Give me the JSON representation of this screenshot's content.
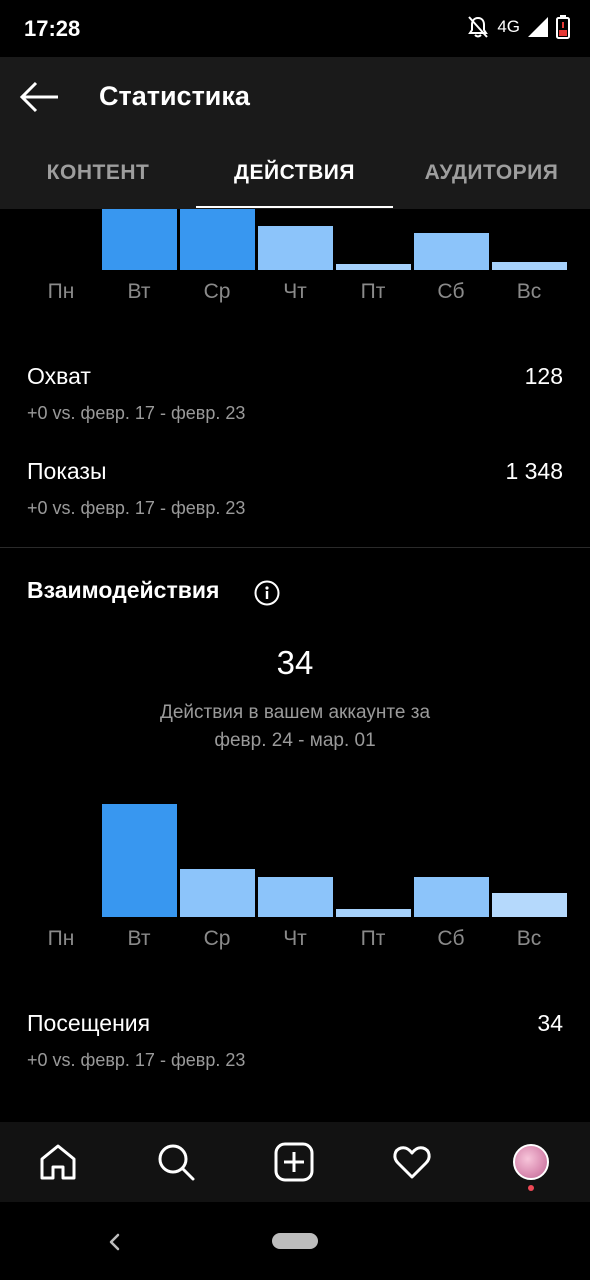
{
  "status_bar": {
    "time": "17:28",
    "network": "4G"
  },
  "header": {
    "title": "Статистика"
  },
  "tabs": [
    {
      "label": "КОНТЕНТ",
      "active": false
    },
    {
      "label": "ДЕЙСТВИЯ",
      "active": true
    },
    {
      "label": "АУДИТОРИЯ",
      "active": false
    }
  ],
  "top_chart": {
    "days": [
      "Пн",
      "Вт",
      "Ср",
      "Чт",
      "Пт",
      "Сб",
      "Вс"
    ]
  },
  "reach": {
    "label": "Охват",
    "value": "128",
    "compare": "+0 vs. февр. 17 - февр. 23"
  },
  "impressions": {
    "label": "Показы",
    "value": "1 348",
    "compare": "+0 vs. февр. 17 - февр. 23"
  },
  "interactions": {
    "title": "Взаимодействия",
    "total": "34",
    "caption_line1": "Действия в вашем аккаунте за",
    "caption_line2": "февр. 24 - мар. 01"
  },
  "chart_data": {
    "type": "bar",
    "categories": [
      "Пн",
      "Вт",
      "Ср",
      "Чт",
      "Пт",
      "Сб",
      "Вс"
    ],
    "values": [
      0,
      14,
      6,
      5,
      1,
      5,
      3
    ],
    "xlabel": "",
    "ylabel": "",
    "colors": {
      "highest": "#3897f0",
      "other": "#8cc4fa"
    }
  },
  "visits": {
    "label": "Посещения",
    "value": "34",
    "compare": "+0 vs. февр. 17 - февр. 23"
  },
  "bottom_nav": [
    "home-icon",
    "search-icon",
    "new-post-icon",
    "activity-heart-icon",
    "profile-avatar"
  ]
}
